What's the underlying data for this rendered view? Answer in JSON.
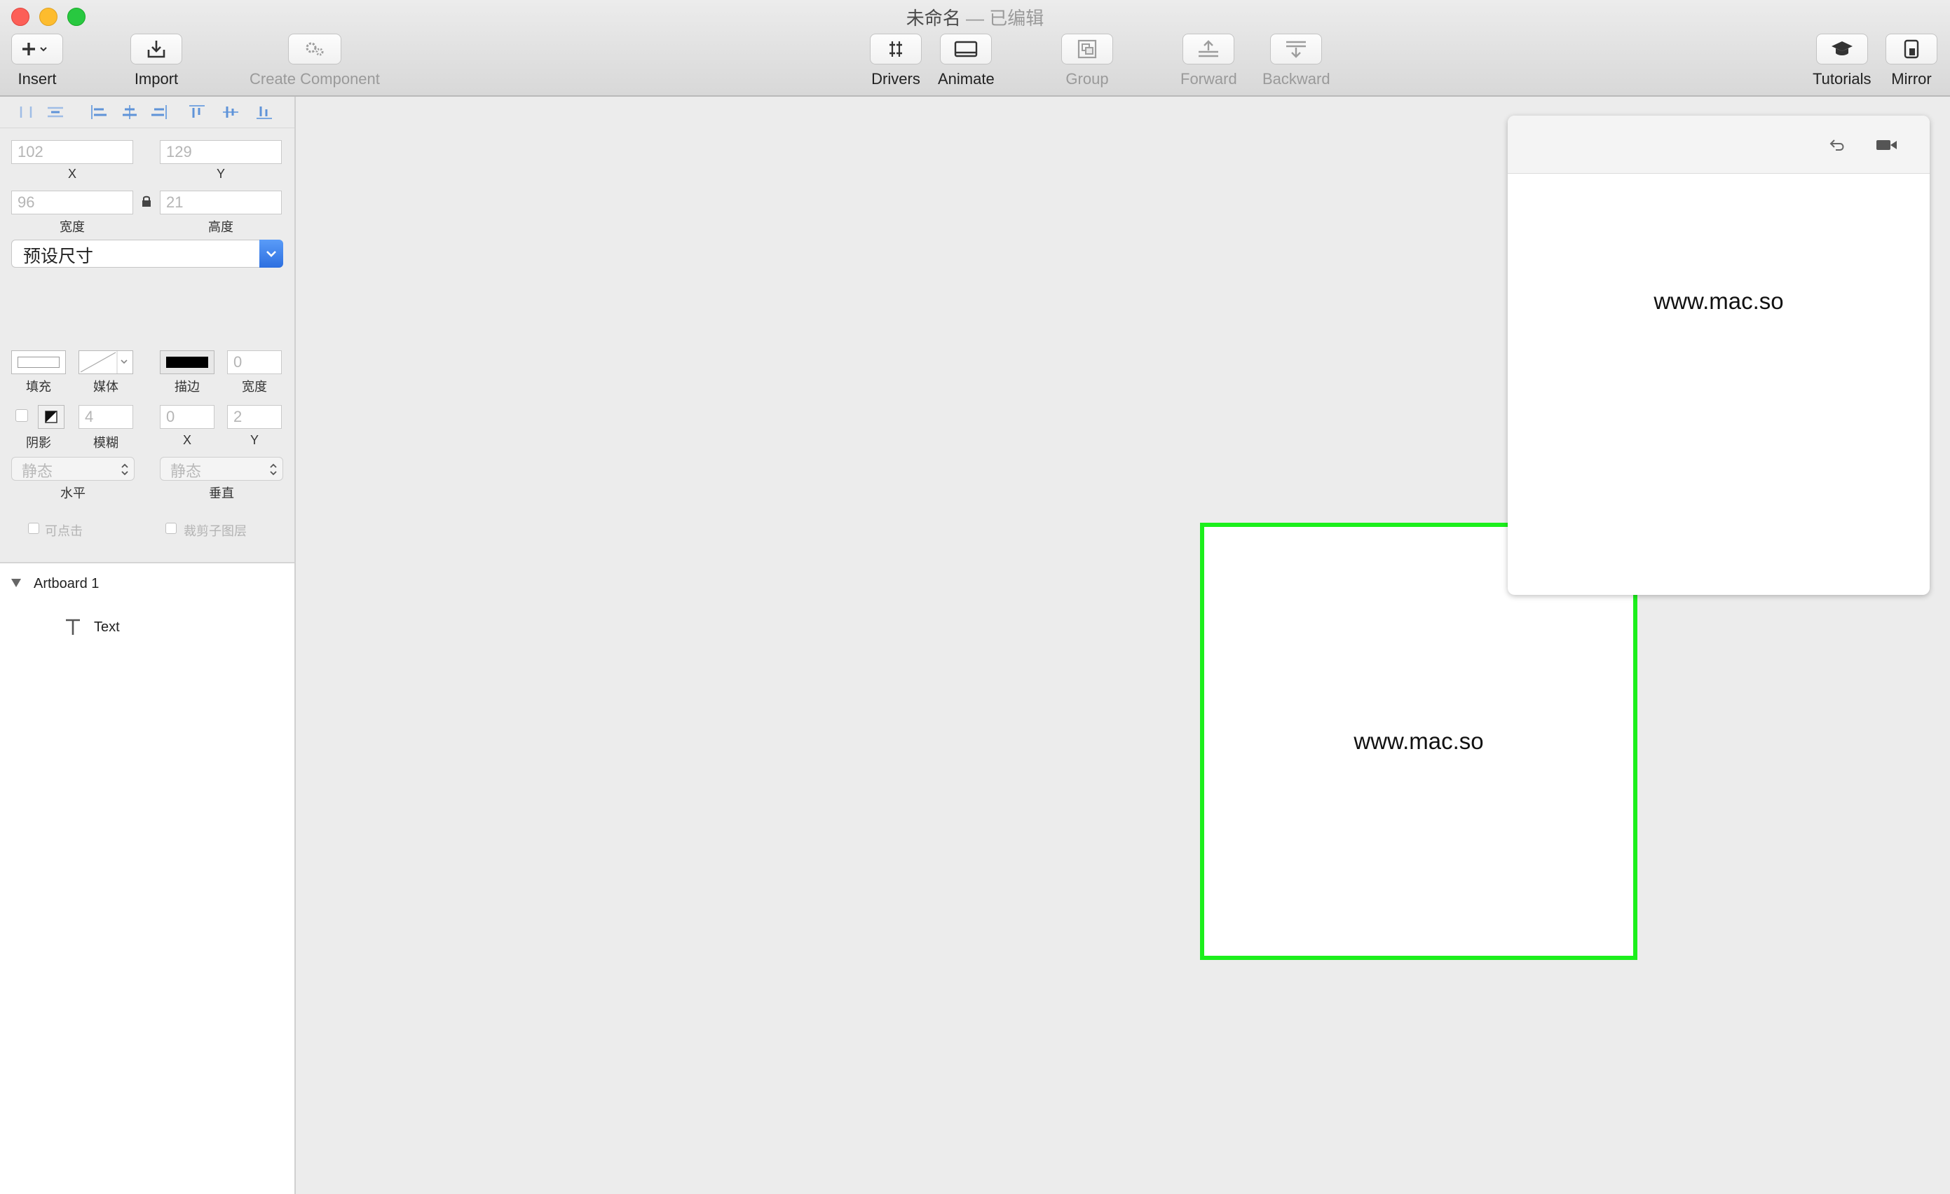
{
  "window": {
    "title": "未命名",
    "edited_suffix": "— 已编辑"
  },
  "toolbar": {
    "insert": "Insert",
    "import": "Import",
    "create_component": "Create Component",
    "drivers": "Drivers",
    "animate": "Animate",
    "group": "Group",
    "forward": "Forward",
    "backward": "Backward",
    "tutorials": "Tutorials",
    "mirror": "Mirror"
  },
  "inspector": {
    "x_value": "102",
    "x_label": "X",
    "y_value": "129",
    "y_label": "Y",
    "width_value": "96",
    "width_label": "宽度",
    "height_value": "21",
    "height_label": "高度",
    "preset_size": "预设尺寸",
    "fill_label": "填充",
    "media_label": "媒体",
    "stroke_label": "描边",
    "stroke_width_value": "0",
    "stroke_width_label": "宽度",
    "shadow_label": "阴影",
    "blur_value": "4",
    "blur_label": "模糊",
    "shadow_x_value": "0",
    "shadow_x_label": "X",
    "shadow_y_value": "2",
    "shadow_y_label": "Y",
    "horizontal_value": "静态",
    "horizontal_label": "水平",
    "vertical_value": "静态",
    "vertical_label": "垂直",
    "clickable_label": "可点击",
    "clip_children_label": "裁剪子图层"
  },
  "layers": {
    "artboard": "Artboard 1",
    "text_layer": "Text"
  },
  "canvas": {
    "artboard_text": "www.mac.so"
  },
  "preview": {
    "text": "www.mac.so"
  },
  "colors": {
    "selection_border": "#1cef1c",
    "dropdown_accent": "#2d6fe0"
  }
}
